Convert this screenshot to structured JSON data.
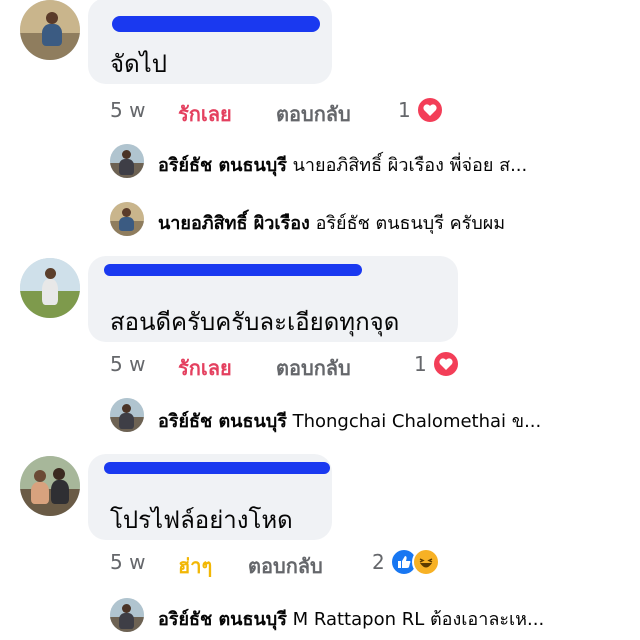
{
  "comments": [
    {
      "text": "จัดไป",
      "time": "5 w",
      "reaction_label": "รักเลย",
      "reply_label": "ตอบกลับ",
      "reaction_count": "1",
      "reaction_icons": [
        "heart-icon"
      ],
      "replies": [
        {
          "author": "อริย์ธัช ตนธนบุรี",
          "text": "นายอภิสิทธิ์ ผิวเรือง พี่จ่อย ส..."
        },
        {
          "author": "นายอภิสิทธิ์ ผิวเรือง",
          "text": "อริย์ธัช ตนธนบุรี ครับผม"
        }
      ]
    },
    {
      "text": "สอนดีครับครับละเอียดทุกจุด",
      "time": "5 w",
      "reaction_label": "รักเลย",
      "reply_label": "ตอบกลับ",
      "reaction_count": "1",
      "reaction_icons": [
        "heart-icon"
      ],
      "replies": [
        {
          "author": "อริย์ธัช ตนธนบุรี",
          "text": "Thongchai Chalomethai ข..."
        }
      ]
    },
    {
      "text": "โปรไฟล์อย่างโหด",
      "time": "5 w",
      "reaction_label": "ฮ่าๆ",
      "reply_label": "ตอบกลับ",
      "reaction_count": "2",
      "reaction_icons": [
        "like-icon",
        "haha-icon"
      ],
      "replies": [
        {
          "author": "อริย์ธัช ตนธนบุรี",
          "text": "M Rattapon RL ต้องเอาละเห..."
        }
      ]
    }
  ],
  "colors": {
    "bubble": "#f0f2f5",
    "redaction": "#1a39f0",
    "love": "#e4405f",
    "haha": "#f2b705",
    "meta": "#65676b"
  }
}
